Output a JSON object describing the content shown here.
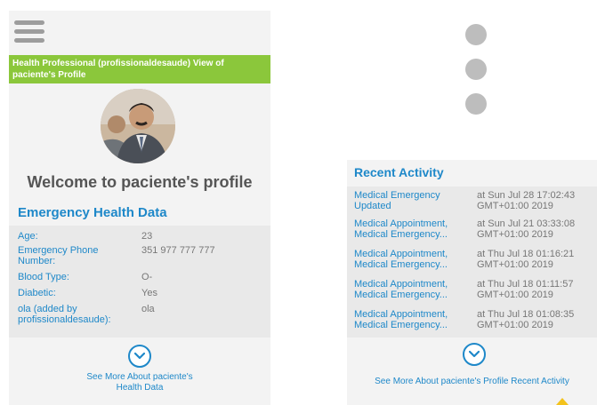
{
  "left_panel": {
    "banner": "Health Professional (profissionaldesaude) View of paciente's Profile",
    "welcome": "Welcome to paciente's profile",
    "section_title": "Emergency Health Data",
    "rows": [
      {
        "label": "Age:",
        "value": "23"
      },
      {
        "label": "Emergency Phone Number:",
        "value": "351 977 777 777"
      },
      {
        "label": "Blood Type:",
        "value": "O-"
      },
      {
        "label": "Diabetic:",
        "value": "Yes"
      },
      {
        "label": "ola (added by profissionaldesaude):",
        "value": "ola"
      }
    ],
    "see_more": "See More About paciente's Health Data"
  },
  "right_panel": {
    "title": "Recent Activity",
    "items": [
      {
        "what": "Medical Emergency Updated",
        "when": "at Sun Jul 28 17:02:43 GMT+01:00 2019"
      },
      {
        "what": "Medical Appointment, Medical Emergency...",
        "when": "at Sun Jul 21 03:33:08 GMT+01:00 2019"
      },
      {
        "what": "Medical Appointment, Medical Emergency...",
        "when": "at Thu Jul 18 01:16:21 GMT+01:00 2019"
      },
      {
        "what": "Medical Appointment, Medical Emergency...",
        "when": "at Thu Jul 18 01:11:57 GMT+01:00 2019"
      },
      {
        "what": "Medical Appointment, Medical Emergency...",
        "when": "at Thu Jul 18 01:08:35 GMT+01:00 2019"
      }
    ],
    "see_more": "See More About paciente's Profile Recent Activity"
  },
  "colors": {
    "accent_blue": "#1e88c9",
    "banner_green": "#8bc73b",
    "panel_bg": "#f3f3f3",
    "table_bg": "#e9e9e9",
    "dot_grey": "#bdbdbd",
    "marker_yellow": "#f3c21c"
  },
  "icons": {
    "menu": "hamburger-menu-icon",
    "expand": "chevron-down-circle-icon",
    "more": "vertical-dots-icon",
    "avatar": "profile-photo"
  }
}
